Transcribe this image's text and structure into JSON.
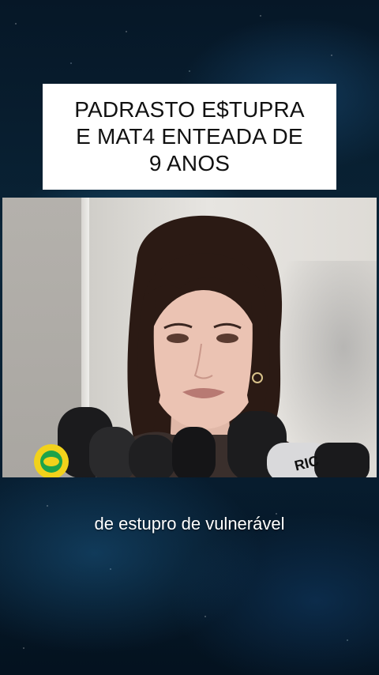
{
  "title": {
    "text": "PADRASTO E$TUPRA\nE MAT4 ENTEADA DE\n9 ANOS"
  },
  "video": {
    "mic_brand_right": "RIC"
  },
  "caption": {
    "text": "de estupro de vulnerável"
  },
  "colors": {
    "background": "#04121f",
    "title_box": "#ffffff",
    "title_text": "#111111",
    "caption_text": "#ffffff"
  }
}
